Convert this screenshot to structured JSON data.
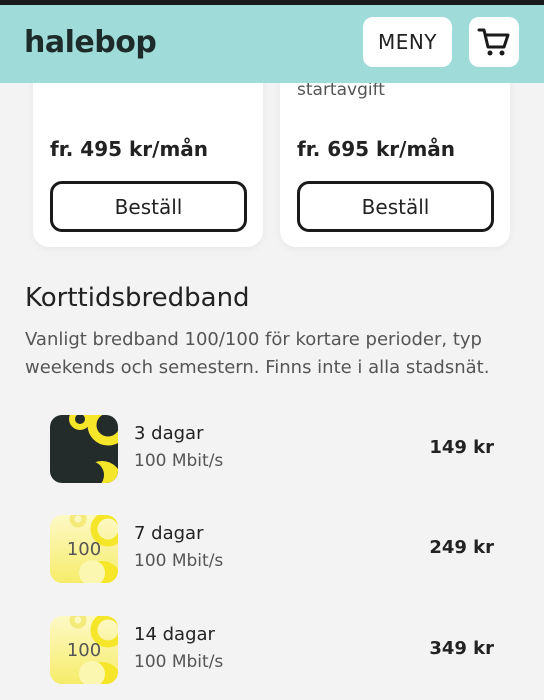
{
  "header": {
    "logo": "halebop",
    "menu_label": "MENY",
    "cart_icon": "cart-icon"
  },
  "cards": [
    {
      "fee_text": "",
      "price": "fr. 495 kr/mån",
      "order_label": "Beställ"
    },
    {
      "fee_text": "startavgift",
      "price": "fr. 695 kr/mån",
      "order_label": "Beställ"
    }
  ],
  "section": {
    "title": "Korttidsbredband",
    "description": "Vanligt bredband 100/100 för kortare perioder, typ weekends och semestern. Finns inte i alla stadsnät."
  },
  "items": [
    {
      "name": "3 dagar",
      "speed": "100 Mbit/s",
      "price": "149 kr",
      "thumb_text": ""
    },
    {
      "name": "7 dagar",
      "speed": "100 Mbit/s",
      "price": "249 kr",
      "thumb_text": "100"
    },
    {
      "name": "14 dagar",
      "speed": "100 Mbit/s",
      "price": "349 kr",
      "thumb_text": "100"
    }
  ],
  "colors": {
    "header_bg": "#9fdbd8",
    "dark_thumb": "#232b2b",
    "yellow": "#f5e62a",
    "light_yellow": "#fbf6b0"
  }
}
